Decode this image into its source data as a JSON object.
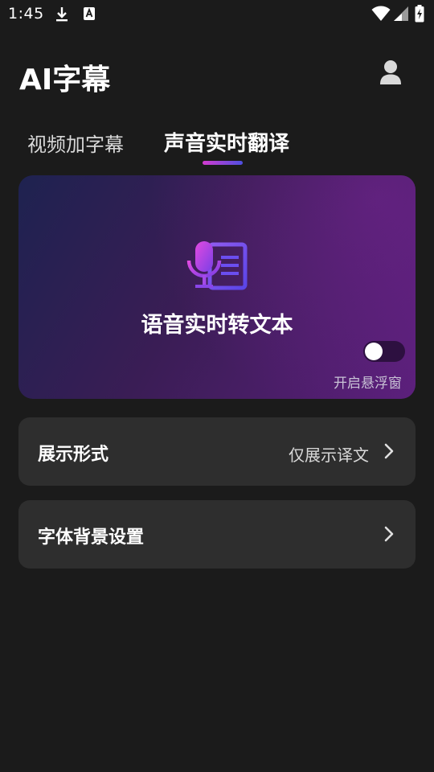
{
  "status_bar": {
    "time": "1:45",
    "icons": [
      "download-icon",
      "font-a-icon",
      "wifi-icon",
      "signal-icon",
      "battery-charging-icon"
    ]
  },
  "header": {
    "title": "AI字幕",
    "profile_icon": "user-icon"
  },
  "tabs": [
    {
      "label": "视频加字幕",
      "active": false
    },
    {
      "label": "声音实时翻译",
      "active": true
    }
  ],
  "feature_card": {
    "icon": "mic-transcript-icon",
    "title": "语音实时转文本",
    "toggle_state": "off",
    "toggle_label": "开启悬浮窗"
  },
  "settings": [
    {
      "label": "展示形式",
      "value": "仅展示译文",
      "icon": "chevron-right-icon"
    },
    {
      "label": "字体背景设置",
      "value": "",
      "icon": "chevron-right-icon"
    }
  ],
  "colors": {
    "background": "#1b1b1b",
    "card_start": "#1e2250",
    "card_end": "#5a1f7a",
    "accent_pink": "#d43bd0",
    "accent_blue": "#4d4fe0",
    "row_bg": "#2e2e2e"
  }
}
